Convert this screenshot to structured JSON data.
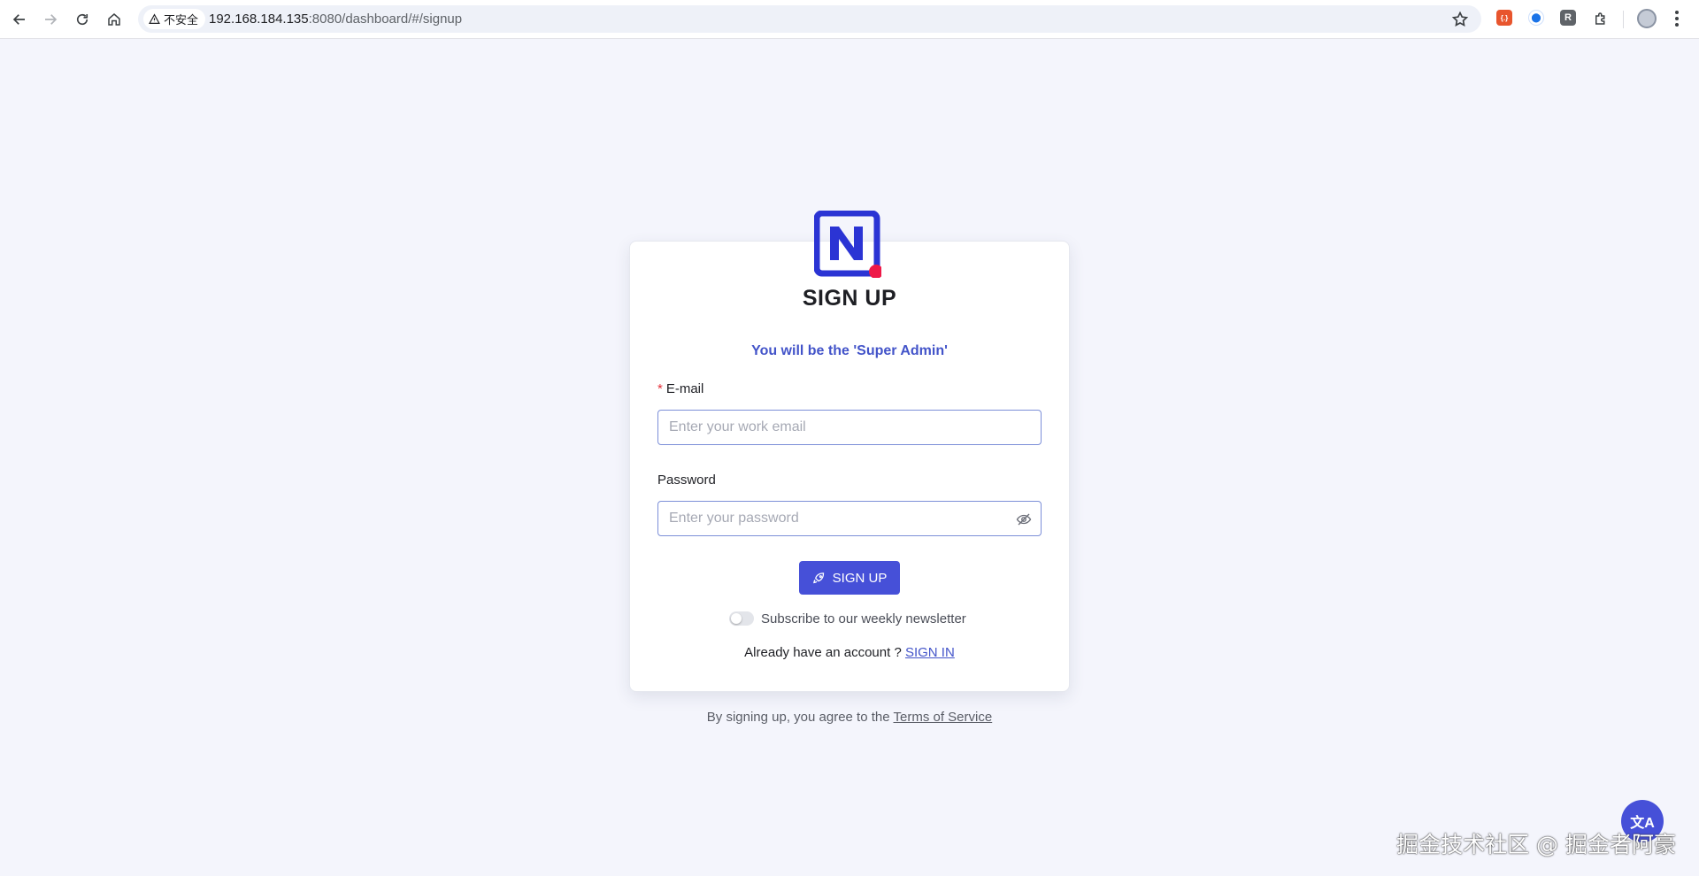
{
  "browser": {
    "security_label": "不安全",
    "url_host": "192.168.184.135",
    "url_rest": ":8080/dashboard/#/signup",
    "extensions": [
      {
        "name": "ext-orange",
        "glyph": "{.}",
        "color": "#e8552d"
      },
      {
        "name": "ext-blue",
        "glyph": "⬤",
        "color": "#1a73e8"
      },
      {
        "name": "ext-r",
        "glyph": "R",
        "color": "#5f6368"
      }
    ]
  },
  "signup": {
    "title": "SIGN UP",
    "subtitle": "You will be the 'Super Admin'",
    "email": {
      "required_mark": "*",
      "label": "E-mail",
      "placeholder": "Enter your work email",
      "value": ""
    },
    "password": {
      "label": "Password",
      "placeholder": "Enter your password",
      "value": ""
    },
    "submit_label": "SIGN UP",
    "newsletter": {
      "label": "Subscribe to our weekly newsletter",
      "checked": false
    },
    "signin_prompt": "Already have an account ?",
    "signin_link": "SIGN IN",
    "terms_prefix": "By signing up, you agree to the",
    "terms_link": "Terms of Service"
  },
  "translate_fab": {
    "glyph": "文A"
  },
  "watermark": "掘金技术社区 @ 掘金者阿豪",
  "colors": {
    "brand": "#2b34d4",
    "accent": "#4650d8",
    "logo_dot": "#ee1948",
    "background": "#f4f5fc"
  }
}
